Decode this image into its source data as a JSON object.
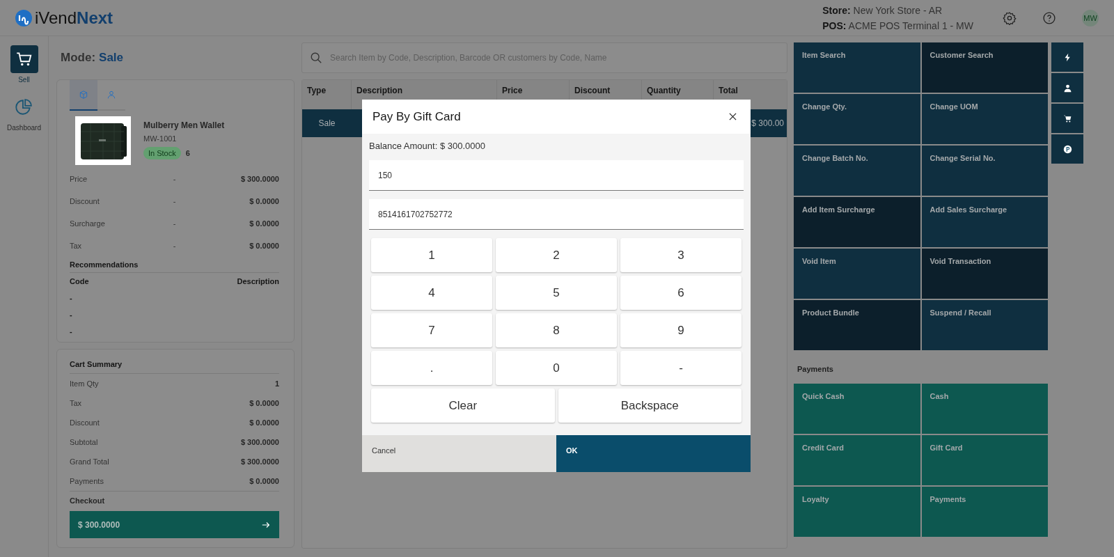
{
  "header": {
    "logo_prefix": "iVend",
    "logo_suffix": "Next",
    "store_label": "Store:",
    "store_value": "New York Store - AR",
    "pos_label": "POS:",
    "pos_value": "ACME POS Terminal 1 - MW",
    "avatar": "MW"
  },
  "nav": [
    {
      "kind": "cart",
      "label": "Sell",
      "selected": true
    },
    {
      "kind": "pie",
      "label": "Dashboard",
      "selected": false
    }
  ],
  "mode": {
    "label": "Mode:",
    "value": "Sale"
  },
  "product_tabs": [
    {
      "kind": "box",
      "selected": true
    },
    {
      "kind": "person",
      "selected": false
    }
  ],
  "product": {
    "name": "Mulberry Men Wallet",
    "code": "MW-1001",
    "stock": "In Stock",
    "quantity": "6",
    "rows": [
      {
        "label": "Price",
        "middle": "-",
        "value": "$ 300.0000"
      },
      {
        "label": "Discount",
        "middle": "-",
        "value": "$ 0.0000"
      },
      {
        "label": "Surcharge",
        "middle": "-",
        "value": "$ 0.0000"
      },
      {
        "label": "Tax",
        "middle": "-",
        "value": "$ 0.0000"
      }
    ]
  },
  "recommendations": {
    "title": "Recommendations",
    "columns": [
      "Code",
      "Description"
    ],
    "rows": [
      "-",
      "-",
      "-"
    ]
  },
  "cart_summary": {
    "title": "Cart Summary",
    "rows": [
      {
        "label": "Item Qty",
        "value": "1"
      },
      {
        "label": "Tax",
        "value": "$ 0.0000"
      },
      {
        "label": "Discount",
        "value": "$ 0.0000"
      },
      {
        "label": "Subtotal",
        "value": "$ 300.0000"
      },
      {
        "label": "Grand Total",
        "value": "$ 300.0000"
      },
      {
        "label": "Payments",
        "value": "$ 0.0000"
      }
    ],
    "checkout_label": "Checkout",
    "checkout_amount": "$ 300.0000"
  },
  "search": {
    "placeholder": "Search Item by Code, Description, Barcode OR customers by Code, Name"
  },
  "table": {
    "columns": [
      "Type",
      "Description",
      "Price",
      "Discount",
      "Quantity",
      "Total"
    ],
    "rows": [
      {
        "type": "Sale",
        "total": "$ 300.00",
        "selected": true
      }
    ]
  },
  "actions": [
    {
      "label": "Item Search",
      "color": "#0f2f40"
    },
    {
      "label": "Customer Search",
      "color": "#0c1f2b"
    },
    {
      "label": "Change Qty.",
      "color": "#0f2f40"
    },
    {
      "label": "Change UOM",
      "color": "#0f2f40"
    },
    {
      "label": "Change Batch No.",
      "color": "#0f2f40"
    },
    {
      "label": "Change Serial No.",
      "color": "#0f2f40"
    },
    {
      "label": "Add Item Surcharge",
      "color": "#0c1f2b"
    },
    {
      "label": "Add Sales Surcharge",
      "color": "#0f2f40"
    },
    {
      "label": "Void Item",
      "color": "#0f2f40"
    },
    {
      "label": "Void Transaction",
      "color": "#0c1f2b"
    },
    {
      "label": "Product Bundle",
      "color": "#0c1f2b"
    },
    {
      "label": "Suspend / Recall",
      "color": "#0f2f40"
    }
  ],
  "side_buttons": [
    {
      "kind": "bolt"
    },
    {
      "kind": "person"
    },
    {
      "kind": "cart"
    },
    {
      "kind": "coin"
    }
  ],
  "payments": {
    "title": "Payments",
    "tiles": [
      "Quick Cash",
      "Cash",
      "Credit Card",
      "Gift Card",
      "Loyalty",
      "Payments"
    ]
  },
  "modal": {
    "title": "Pay By Gift Card",
    "balance": "Balance Amount: $ 300.0000",
    "amount_value": "150",
    "card_value": "8514161702752772",
    "keys": [
      "1",
      "2",
      "3",
      "4",
      "5",
      "6",
      "7",
      "8",
      "9",
      ".",
      "0",
      "-"
    ],
    "wide_keys": [
      "Clear",
      "Backspace"
    ],
    "cancel": "Cancel",
    "ok": "OK"
  }
}
